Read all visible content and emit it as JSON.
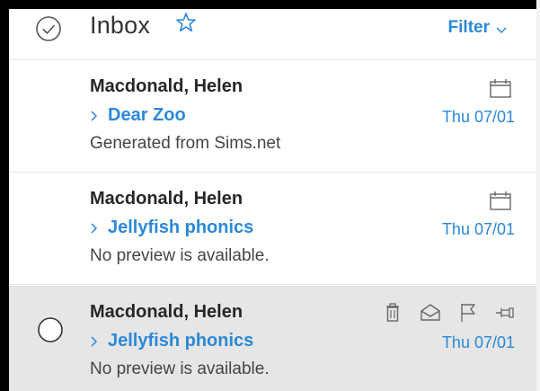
{
  "header": {
    "title": "Inbox",
    "filter_label": "Filter"
  },
  "messages": [
    {
      "sender": "Macdonald, Helen",
      "subject": "Dear Zoo",
      "date": "Thu 07/01",
      "preview": "Generated from Sims.net"
    },
    {
      "sender": "Macdonald, Helen",
      "subject": "Jellyfish phonics",
      "date": "Thu 07/01",
      "preview": "No preview is available."
    },
    {
      "sender": "Macdonald, Helen",
      "subject": "Jellyfish phonics",
      "date": "Thu 07/01",
      "preview": "No preview is available."
    }
  ],
  "icons": {
    "select_all": "check-circle-icon",
    "favorite": "star-icon",
    "filter": "chevron-down-icon",
    "subject_expand": "chevron-right-icon",
    "calendar": "calendar-icon",
    "delete": "trash-icon",
    "mark_read": "envelope-open-icon",
    "flag": "flag-icon",
    "pin": "pin-icon",
    "select_row": "radio-circle-icon"
  },
  "colors": {
    "accent": "#2b88d8",
    "hover_row": "#e6e6e6"
  }
}
